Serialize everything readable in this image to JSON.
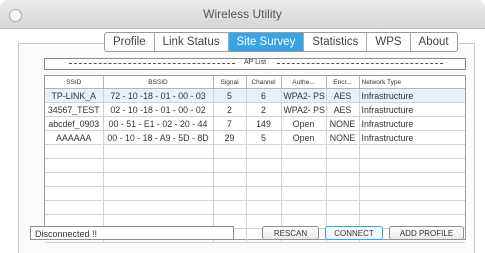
{
  "window": {
    "title": "Wireless Utility"
  },
  "tabs": [
    {
      "label": "Profile",
      "active": false
    },
    {
      "label": "Link Status",
      "active": false
    },
    {
      "label": "Site Survey",
      "active": true
    },
    {
      "label": "Statistics",
      "active": false
    },
    {
      "label": "WPS",
      "active": false
    },
    {
      "label": "About",
      "active": false
    }
  ],
  "ap_list": {
    "label": "AP List"
  },
  "table": {
    "columns": [
      "SSID",
      "BSSID",
      "Signal",
      "Channel",
      "Authe...",
      "Encr...",
      "Network Type"
    ],
    "rows": [
      [
        "TP-LINK_A",
        "72 - 10 -18 - 01 - 00 - 03",
        "5",
        "6",
        "WPA2- PS",
        "AES",
        "Infrastructure"
      ],
      [
        "34567_TEST",
        "02 - 10 -18 - 01 - 00 - 02",
        "2",
        "2",
        "WPA2- PS",
        "AES",
        "Infrastructure"
      ],
      [
        "abcdef_0903",
        "00 - 51 - E1 - 02 - 20 - 44",
        "7",
        "149",
        "Open",
        "NONE",
        "Infrastructure"
      ],
      [
        "AAAAAA",
        "00 - 10 - 18 - A9 - 5D - 8D",
        "29",
        "5",
        "Open",
        "NONE",
        "Infrastructure"
      ]
    ],
    "selected_row": 0,
    "empty_rows": 7
  },
  "status": {
    "text": "Disconnected !!"
  },
  "buttons": {
    "rescan": "RESCAN",
    "connect": "CONNECT",
    "add_profile": "ADD PROFILE"
  },
  "colors": {
    "accent": "#3aa3e3",
    "selected_row": "#e3f2fc"
  }
}
